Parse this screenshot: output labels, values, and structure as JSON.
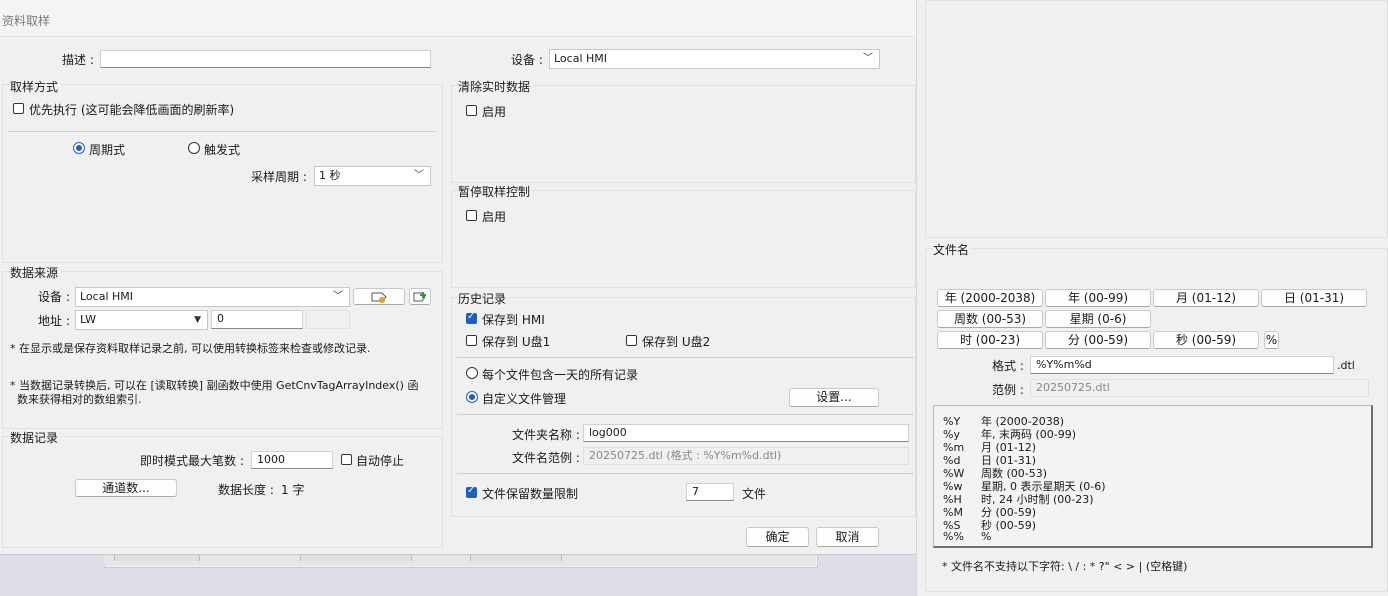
{
  "background": {
    "title_fragment": "资料取样"
  },
  "dialog": {
    "title": "资料取样",
    "description_label": "描述 :",
    "description_value": "",
    "device_label": "设备 :",
    "device_value": "Local HMI",
    "sampling_mode": {
      "title": "取样方式",
      "priority_label": "优先执行 (这可能会降低画面的刷新率)",
      "periodic_label": "周期式",
      "trigger_label": "触发式",
      "period_label": "采样周期 :",
      "period_value": "1 秒"
    },
    "data_source": {
      "title": "数据来源",
      "device_label": "设备 :",
      "device_value": "Local HMI",
      "address_label": "地址 :",
      "address_type": "LW",
      "address_value": "0",
      "note1": "* 在显示或是保存资料取样记录之前, 可以使用转换标签来检查或修改记录.",
      "note2a": "* 当数据记录转换后, 可以在 [读取转换] 副函数中使用 GetCnvTagArrayIndex() 函",
      "note2b": "数来获得相对的数组索引."
    },
    "data_record": {
      "title": "数据记录",
      "max_label": "即时模式最大笔数 :",
      "max_value": "1000",
      "auto_stop_label": "自动停止",
      "channels_button": "通道数...",
      "length_label": "数据长度 :",
      "length_value": "1 字"
    },
    "clear_realtime": {
      "title": "清除实时数据",
      "enable_label": "启用"
    },
    "pause_control": {
      "title": "暂停取样控制",
      "enable_label": "启用"
    },
    "history": {
      "title": "历史记录",
      "save_hmi_label": "保存到 HMI",
      "save_usb1_label": "保存到 U盘1",
      "save_usb2_label": "保存到 U盘2",
      "per_day_label": "每个文件包含一天的所有记录",
      "custom_label": "自定义文件管理",
      "settings_button": "设置...",
      "folder_label": "文件夹名称 :",
      "folder_value": "log000",
      "example_label": "文件名范例 :",
      "example_value": "20250725.dtl (格式 : %Y%m%d.dtl)",
      "limit_label": "文件保留数量限制",
      "limit_value": "7",
      "limit_unit": "文件"
    },
    "ok_button": "确定",
    "cancel_button": "取消"
  },
  "filename_panel": {
    "title": "文件名",
    "buttons": [
      "年 (2000-2038)",
      "年 (00-99)",
      "月 (01-12)",
      "日 (01-31)",
      "周数 (00-53)",
      "星期 (0-6)",
      "时 (00-23)",
      "分 (00-59)",
      "秒 (00-59)",
      "%"
    ],
    "format_label": "格式 :",
    "format_value": "%Y%m%d",
    "format_ext": ".dtl",
    "example_label": "范例 :",
    "example_value": "20250725.dtl",
    "codes": [
      {
        "code": "%Y",
        "desc": "年 (2000-2038)"
      },
      {
        "code": "%y",
        "desc": "年, 末两码 (00-99)"
      },
      {
        "code": "%m",
        "desc": "月 (01-12)"
      },
      {
        "code": "%d",
        "desc": "日 (01-31)"
      },
      {
        "code": "%W",
        "desc": "周数 (00-53)"
      },
      {
        "code": "%w",
        "desc": "星期, 0 表示星期天 (0-6)"
      },
      {
        "code": "%H",
        "desc": "时, 24 小时制 (00-23)"
      },
      {
        "code": "%M",
        "desc": "分 (00-59)"
      },
      {
        "code": "%S",
        "desc": "秒 (00-59)"
      },
      {
        "code": "%%",
        "desc": "%"
      }
    ],
    "note": "* 文件名不支持以下字符: \\ / : * ?\" < > | (空格键)"
  }
}
